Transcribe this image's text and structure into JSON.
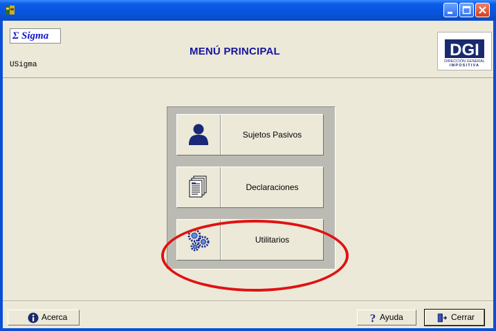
{
  "window": {
    "title": ""
  },
  "header": {
    "logo_text": "Σ Sigma",
    "subtitle": "USigma",
    "title": "MENÚ PRINCIPAL",
    "dgi_line1": "DIRECCIÓN GENERAL",
    "dgi_line2": "IMPOSITIVA"
  },
  "menu": {
    "items": [
      {
        "label": "Sujetos Pasivos",
        "icon": "person-icon"
      },
      {
        "label": "Declaraciones",
        "icon": "documents-icon"
      },
      {
        "label": "Utilitarios",
        "icon": "gears-icon"
      }
    ]
  },
  "footer": {
    "about_label": "Acerca",
    "help_label": "Ayuda",
    "close_label": "Cerrar"
  },
  "colors": {
    "titlebar": "#0B5CE8",
    "background": "#ECE9D8",
    "highlight": "#E01212",
    "title_text": "#15159E"
  }
}
